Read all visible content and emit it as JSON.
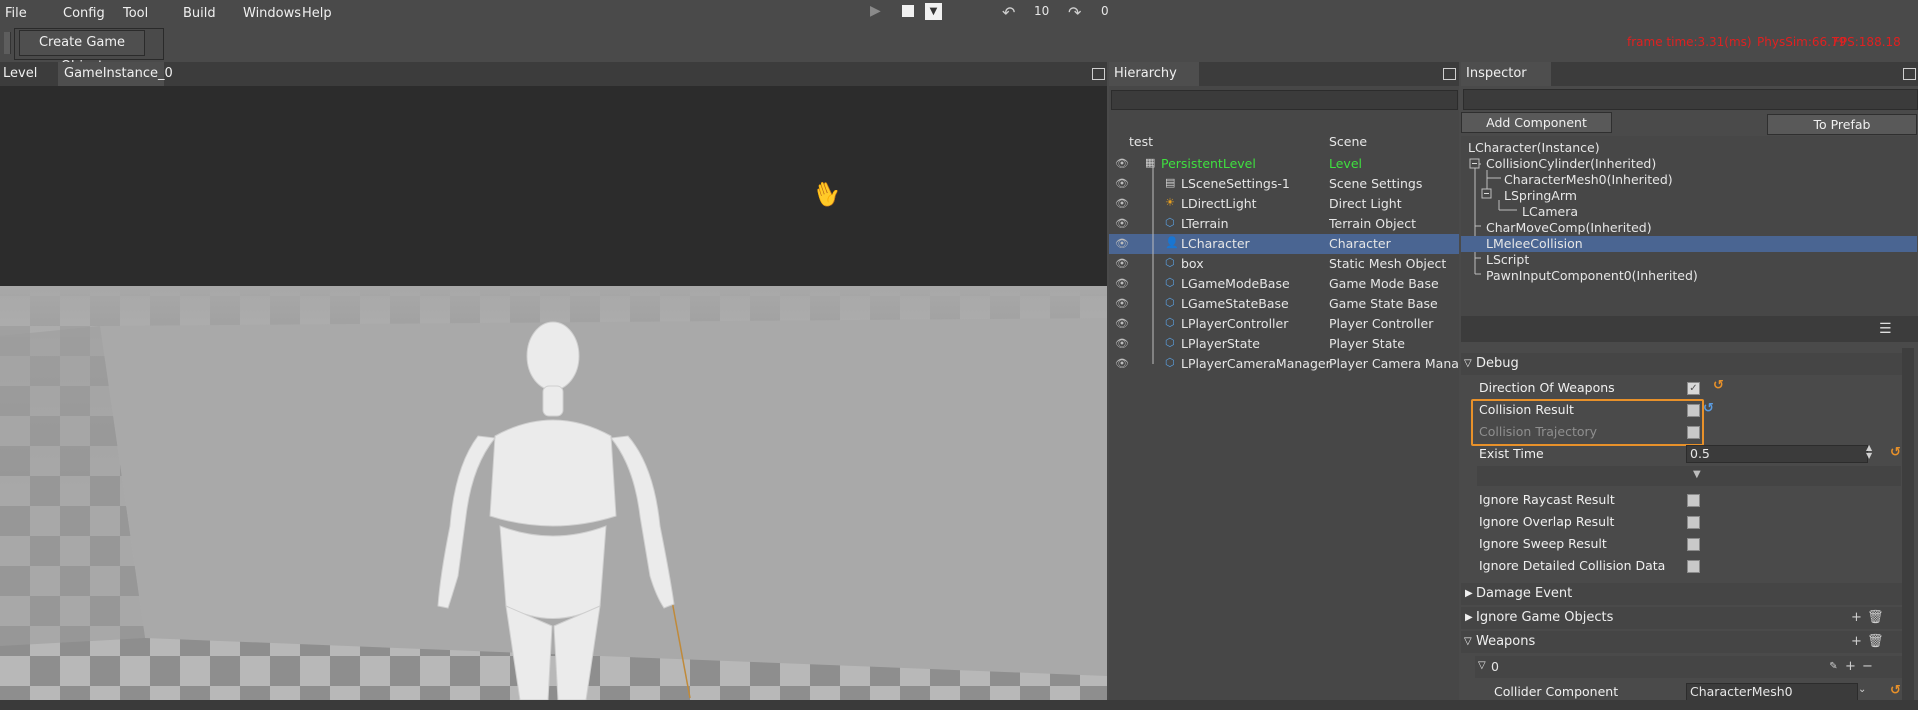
{
  "menu": [
    "File",
    "Config",
    "Tool",
    "Build",
    "Windows",
    "Help"
  ],
  "toolbar": {
    "create_label": "Create Game Object",
    "undo_count": "10",
    "redo_count": "0"
  },
  "stats": {
    "frame_time": "frame time:3.31(ms)",
    "physsim": "PhysSim:66.79",
    "fps": "FPS:188.18"
  },
  "viewport_tabs": [
    "Level",
    "GameInstance_0"
  ],
  "hierarchy": {
    "title": "Hierarchy",
    "header_name": "test",
    "header_type": "Scene",
    "rows": [
      {
        "name": "PersistentLevel",
        "type": "Level",
        "icon": "level-icon"
      },
      {
        "name": "LSceneSettings-1",
        "type": "Scene Settings",
        "icon": "settings-doc-icon"
      },
      {
        "name": "LDirectLight",
        "type": "Direct Light",
        "icon": "sun-icon"
      },
      {
        "name": "LTerrain",
        "type": "Terrain Object",
        "icon": "cube-icon"
      },
      {
        "name": "LCharacter",
        "type": "Character",
        "icon": "person-icon"
      },
      {
        "name": "box",
        "type": "Static Mesh Object",
        "icon": "cube-icon"
      },
      {
        "name": "LGameModeBase",
        "type": "Game Mode Base",
        "icon": "cube-icon"
      },
      {
        "name": "LGameStateBase",
        "type": "Game State Base",
        "icon": "cube-icon"
      },
      {
        "name": "LPlayerController",
        "type": "Player Controller",
        "icon": "cube-icon"
      },
      {
        "name": "LPlayerState",
        "type": "Player State",
        "icon": "cube-icon"
      },
      {
        "name": "LPlayerCameraManager",
        "type": "Player Camera Manag",
        "icon": "cube-icon"
      }
    ]
  },
  "inspector": {
    "title": "Inspector",
    "add_component": "Add Component",
    "to_prefab": "To Prefab",
    "components": [
      "LCharacter(Instance)",
      "CollisionCylinder(Inherited)",
      "CharacterMesh0(Inherited)",
      "LSpringArm",
      "LCamera",
      "CharMoveComp(Inherited)",
      "LMeleeCollision",
      "LScript",
      "PawnInputComponent0(Inherited)"
    ],
    "sections": {
      "debug": "Debug",
      "damage": "Damage Event",
      "ignore": "Ignore Game Objects",
      "weapons": "Weapons",
      "weapon_index": "0"
    },
    "props": {
      "direction_of_weapons": "Direction Of Weapons",
      "collision_result": "Collision Result",
      "collision_trajectory": "Collision Trajectory",
      "exist_time": "Exist Time",
      "exist_time_value": "0.5",
      "ignore_raycast": "Ignore Raycast Result",
      "ignore_overlap": "Ignore Overlap Result",
      "ignore_sweep": "Ignore Sweep Result",
      "ignore_detailed": "Ignore Detailed Collision Data",
      "collider_component": "Collider Component",
      "collider_value": "CharacterMesh0"
    }
  },
  "colors": {
    "selection": "#4a6592",
    "green_level": "#3fe03f",
    "highlight_box": "#e8912a",
    "stats_red": "#e02020"
  }
}
